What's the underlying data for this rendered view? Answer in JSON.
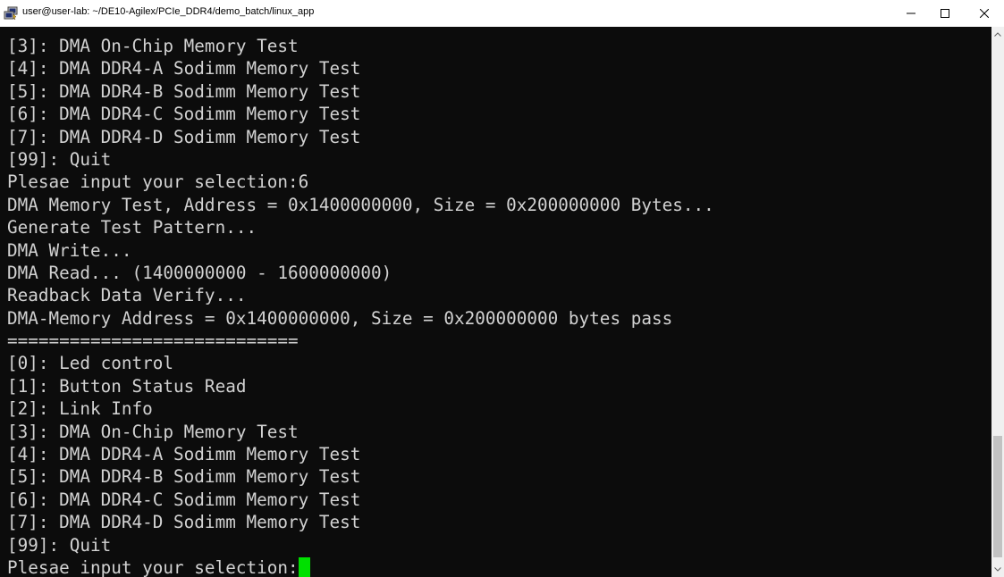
{
  "window": {
    "title": "user@user-lab: ~/DE10-Agilex/PCIe_DDR4/demo_batch/linux_app",
    "app_icon": "putty-terminal-icon",
    "controls": {
      "minimize_icon": "minimize-icon",
      "maximize_icon": "maximize-icon",
      "close_icon": "close-icon"
    }
  },
  "terminal": {
    "lines": [
      "[3]: DMA On-Chip Memory Test",
      "[4]: DMA DDR4-A Sodimm Memory Test",
      "[5]: DMA DDR4-B Sodimm Memory Test",
      "[6]: DMA DDR4-C Sodimm Memory Test",
      "[7]: DMA DDR4-D Sodimm Memory Test",
      "[99]: Quit",
      "Plesae input your selection:6",
      "DMA Memory Test, Address = 0x1400000000, Size = 0x200000000 Bytes...",
      "Generate Test Pattern...",
      "DMA Write...",
      "DMA Read... (1400000000 - 1600000000)",
      "Readback Data Verify...",
      "DMA-Memory Address = 0x1400000000, Size = 0x200000000 bytes pass",
      "============================",
      "[0]: Led control",
      "[1]: Button Status Read",
      "[2]: Link Info",
      "[3]: DMA On-Chip Memory Test",
      "[4]: DMA DDR4-A Sodimm Memory Test",
      "[5]: DMA DDR4-B Sodimm Memory Test",
      "[6]: DMA DDR4-C Sodimm Memory Test",
      "[7]: DMA DDR4-D Sodimm Memory Test",
      "[99]: Quit"
    ],
    "prompt": "Plesae input your selection:",
    "colors": {
      "background": "#0c0c0c",
      "text": "#d2d2d2",
      "cursor": "#00e000"
    }
  },
  "scrollbar": {
    "up_icon": "scroll-up-arrow-icon",
    "down_icon": "scroll-down-arrow-icon"
  }
}
